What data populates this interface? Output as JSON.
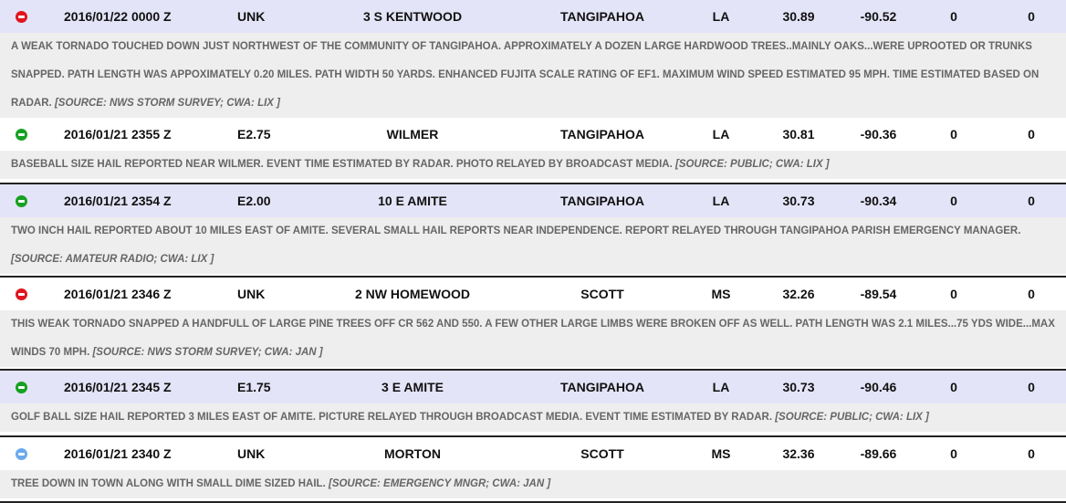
{
  "icon_colors": {
    "tornado": "#e0161e",
    "hail": "#15a121",
    "wind": "#6aa9ee"
  },
  "reports": [
    {
      "icon": "tornado-icon",
      "color_key": "tornado",
      "time": "2016/01/22 0000 Z",
      "magnitude": "UNK",
      "location": "3 S KENTWOOD",
      "county": "TANGIPAHOA",
      "state": "LA",
      "lat": "30.89",
      "lon": "-90.52",
      "injuries": "0",
      "fatalities": "0",
      "description": "A WEAK TORNADO TOUCHED DOWN JUST NORTHWEST OF THE COMMUNITY OF TANGIPAHOA. APPROXIMATELY A DOZEN LARGE HARDWOOD TREES..MAINLY OAKS...WERE UPROOTED OR TRUNKS SNAPPED. PATH LENGTH WAS APPOXIMATELY 0.20 MILES. PATH WIDTH 50 YARDS. ENHANCED FUJITA SCALE RATING OF EF1. MAXIMUM WIND SPEED ESTIMATED 95 MPH. TIME ESTIMATED BASED ON RADAR.",
      "source": "[SOURCE: NWS STORM SURVEY; CWA: LIX ]"
    },
    {
      "icon": "hail-icon",
      "color_key": "hail",
      "time": "2016/01/21 2355 Z",
      "magnitude": "E2.75",
      "location": "WILMER",
      "county": "TANGIPAHOA",
      "state": "LA",
      "lat": "30.81",
      "lon": "-90.36",
      "injuries": "0",
      "fatalities": "0",
      "description": "BASEBALL SIZE HAIL REPORTED NEAR WILMER. EVENT TIME ESTIMATED BY RADAR. PHOTO RELAYED BY BROADCAST MEDIA.",
      "source": "[SOURCE: PUBLIC; CWA: LIX ]"
    },
    {
      "icon": "hail-icon",
      "color_key": "hail",
      "time": "2016/01/21 2354 Z",
      "magnitude": "E2.00",
      "location": "10 E AMITE",
      "county": "TANGIPAHOA",
      "state": "LA",
      "lat": "30.73",
      "lon": "-90.34",
      "injuries": "0",
      "fatalities": "0",
      "description": "TWO INCH HAIL REPORTED ABOUT 10 MILES EAST OF AMITE. SEVERAL SMALL HAIL REPORTS NEAR INDEPENDENCE. REPORT RELAYED THROUGH TANGIPAHOA PARISH EMERGENCY MANAGER.",
      "source": "[SOURCE: AMATEUR RADIO; CWA: LIX ]"
    },
    {
      "icon": "tornado-icon",
      "color_key": "tornado",
      "time": "2016/01/21 2346 Z",
      "magnitude": "UNK",
      "location": "2 NW HOMEWOOD",
      "county": "SCOTT",
      "state": "MS",
      "lat": "32.26",
      "lon": "-89.54",
      "injuries": "0",
      "fatalities": "0",
      "description": "THIS WEAK TORNADO SNAPPED A HANDFULL OF LARGE PINE TREES OFF CR 562 AND 550. A FEW OTHER LARGE LIMBS WERE BROKEN OFF AS WELL. PATH LENGTH WAS 2.1 MILES...75 YDS WIDE...MAX WINDS 70 MPH.",
      "source": "[SOURCE: NWS STORM SURVEY; CWA: JAN ]"
    },
    {
      "icon": "hail-icon",
      "color_key": "hail",
      "time": "2016/01/21 2345 Z",
      "magnitude": "E1.75",
      "location": "3 E AMITE",
      "county": "TANGIPAHOA",
      "state": "LA",
      "lat": "30.73",
      "lon": "-90.46",
      "injuries": "0",
      "fatalities": "0",
      "description": "GOLF BALL SIZE HAIL REPORTED 3 MILES EAST OF AMITE. PICTURE RELAYED THROUGH BROADCAST MEDIA. EVENT TIME ESTIMATED BY RADAR.",
      "source": "[SOURCE: PUBLIC; CWA: LIX ]"
    },
    {
      "icon": "wind-icon",
      "color_key": "wind",
      "time": "2016/01/21 2340 Z",
      "magnitude": "UNK",
      "location": "MORTON",
      "county": "SCOTT",
      "state": "MS",
      "lat": "32.36",
      "lon": "-89.66",
      "injuries": "0",
      "fatalities": "0",
      "description": "TREE DOWN IN TOWN ALONG WITH SMALL DIME SIZED HAIL.",
      "source": "[SOURCE: EMERGENCY MNGR; CWA: JAN ]"
    }
  ]
}
